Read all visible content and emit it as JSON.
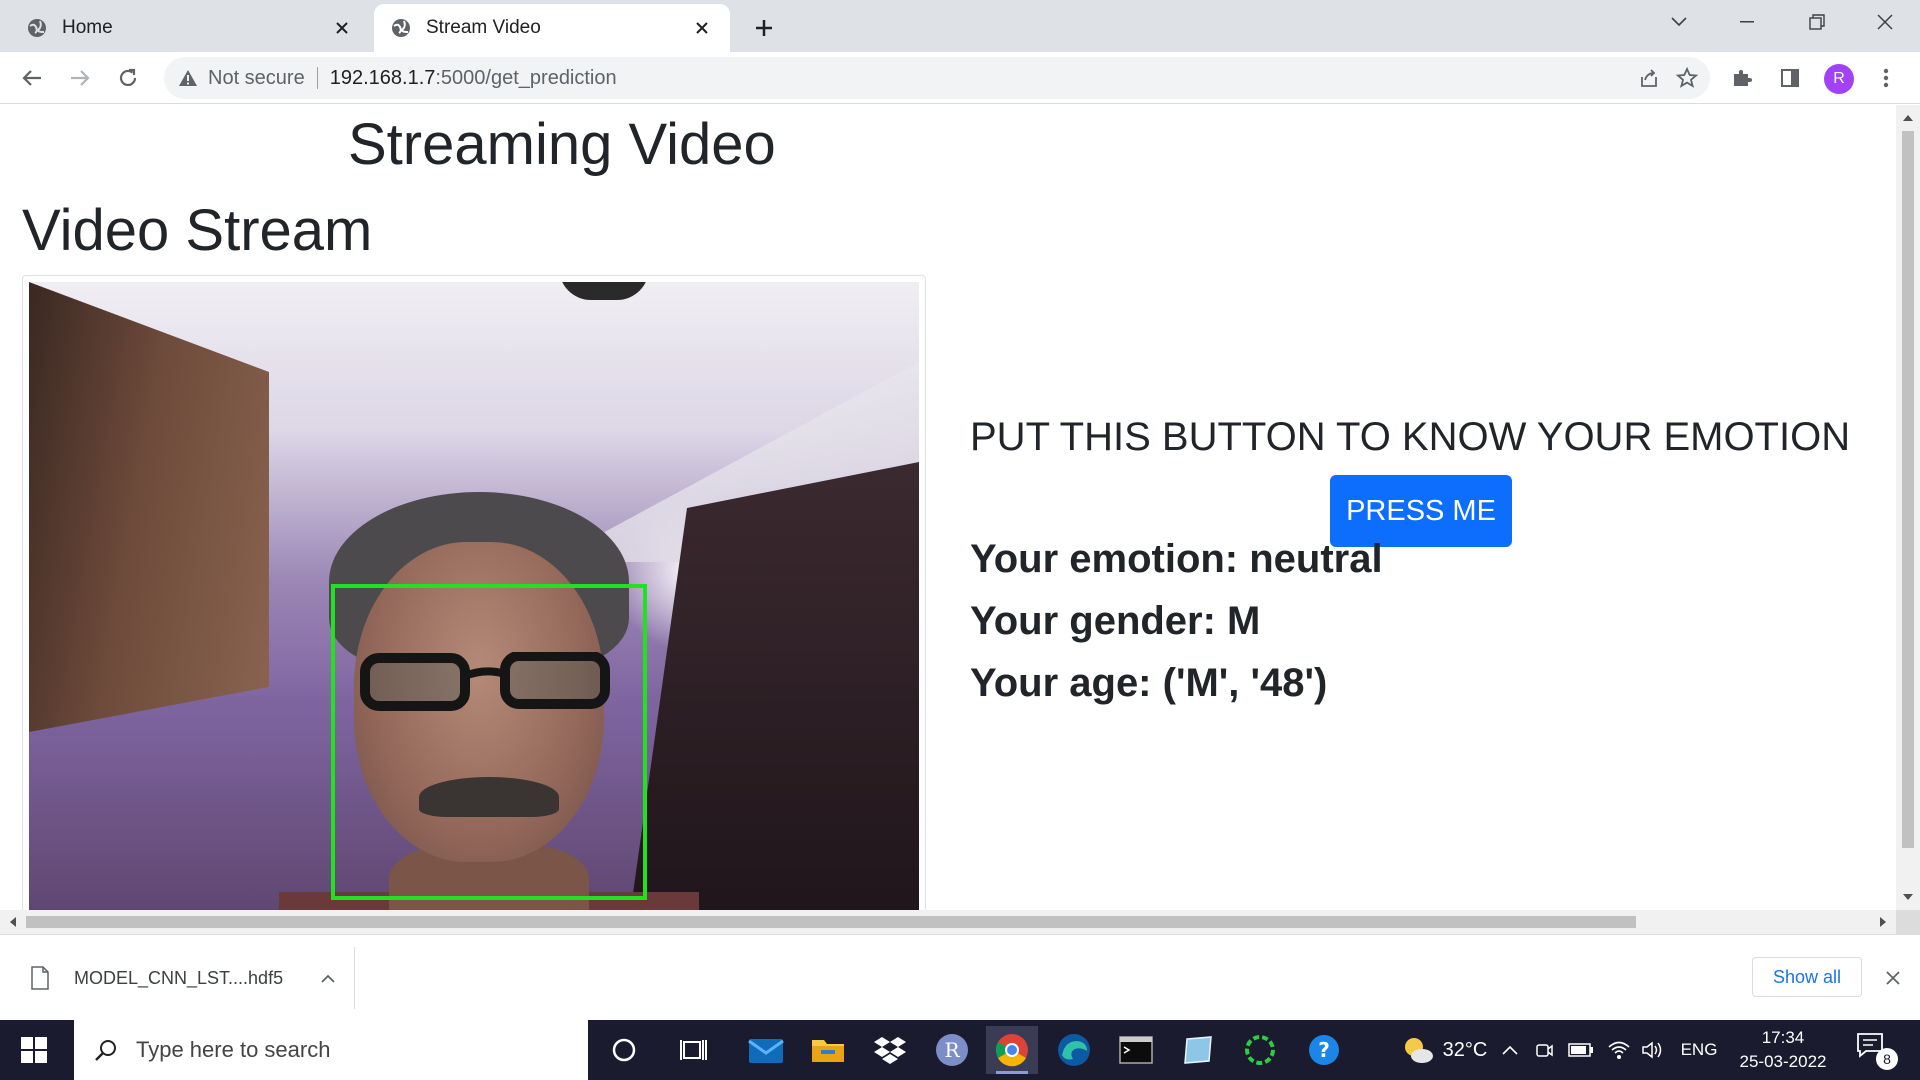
{
  "browser": {
    "tabs": [
      {
        "title": "Home",
        "active": false
      },
      {
        "title": "Stream Video",
        "active": true
      }
    ],
    "security_label": "Not secure",
    "url_host": "192.168.1.7",
    "url_path": ":5000/get_prediction",
    "profile_initial": "R",
    "profile_color": "#a142f4"
  },
  "page": {
    "heading": "Streaming Video",
    "section_heading": "Video Stream",
    "emotion_prompt": "PUT THIS BUTTON TO KNOW YOUR EMOTION",
    "button_label": "PRESS ME",
    "button_color": "#0d6efd",
    "results": {
      "emotion": "Your emotion: neutral",
      "gender": "Your gender: M",
      "age": "Your age: ('M', '48')"
    },
    "face_box_color": "#22e022"
  },
  "download_shelf": {
    "file_name": "MODEL_CNN_LST....hdf5",
    "show_all_label": "Show all"
  },
  "taskbar": {
    "search_placeholder": "Type here to search",
    "weather": "32°C",
    "language": "ENG",
    "time": "17:34",
    "date": "25-03-2022",
    "notification_count": "8",
    "pinned_apps": [
      "cortana-icon",
      "task-view-icon",
      "mail-icon",
      "file-explorer-icon",
      "dropbox-icon",
      "r-app-icon",
      "chrome-icon",
      "edge-icon",
      "terminal-icon",
      "notepad-icon",
      "loader-app-icon",
      "help-icon"
    ]
  }
}
